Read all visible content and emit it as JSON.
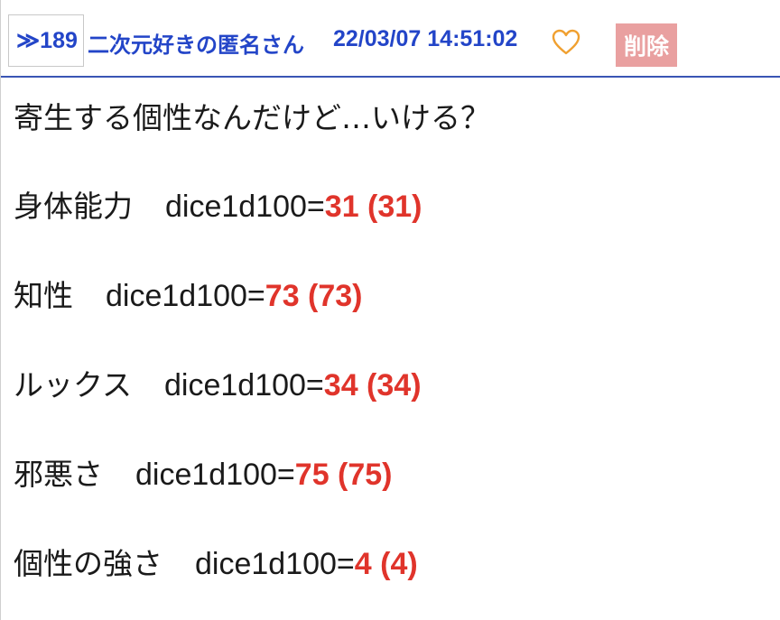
{
  "header": {
    "anchor": "≫189",
    "name": "二次元好きの匿名さん",
    "date": "22/03/07 14:51:02",
    "delete_label": "削除"
  },
  "colors": {
    "link": "#2345c8",
    "heart": "#f0a030",
    "delete_bg": "#e9a0a0",
    "dice_result": "#e0342b",
    "divider": "#3a55b4"
  },
  "body": {
    "intro": "寄生する個性なんだけど…いける？",
    "rolls": [
      {
        "label": "身体能力",
        "expr": "dice1d100=",
        "result": "31 (31)"
      },
      {
        "label": "知性",
        "expr": "dice1d100=",
        "result": "73 (73)"
      },
      {
        "label": "ルックス",
        "expr": "dice1d100=",
        "result": "34 (34)"
      },
      {
        "label": "邪悪さ",
        "expr": "dice1d100=",
        "result": "75 (75)"
      },
      {
        "label": "個性の強さ",
        "expr": "dice1d100=",
        "result": "4 (4)"
      }
    ]
  }
}
